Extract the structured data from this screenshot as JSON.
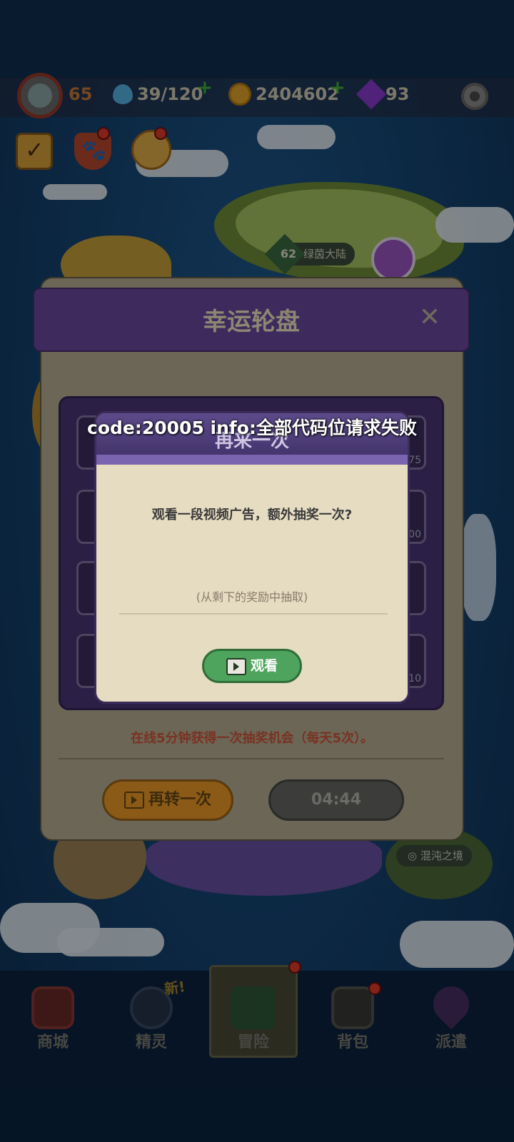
{
  "resources": {
    "level": "65",
    "energy": "39/120",
    "coins": "2404602",
    "gems": "93",
    "plus": "+"
  },
  "map": {
    "island_level": "62",
    "island_name": "绿茵大陆",
    "chaos_name": "混沌之境",
    "chaos_icon": "◎"
  },
  "wheel_panel": {
    "title": "幸运轮盘",
    "close": "✕",
    "prizes": [
      "75",
      "00",
      "10"
    ],
    "rule": "在线5分钟获得一次抽奖机会（每天5次）。",
    "spin_label": "再转一次",
    "timer": "04:44"
  },
  "ad_modal": {
    "title": "再来一次",
    "message": "观看一段视频广告，额外抽奖一次?",
    "sub": "(从剩下的奖励中抽取)",
    "watch_label": "观看"
  },
  "toast": {
    "error": "code:20005 info:全部代码位请求失败"
  },
  "nav": {
    "new_tag": "新!",
    "items": [
      {
        "label": "商城"
      },
      {
        "label": "精灵"
      },
      {
        "label": "冒险"
      },
      {
        "label": "背包"
      },
      {
        "label": "派遣"
      }
    ]
  },
  "colors": {
    "dialog_bg": "#e6dcc2",
    "dialog_header": "#4d3c7a",
    "watch_button": "#4ea45c",
    "rule_text": "#7a3222",
    "notification": "#e23b2b"
  }
}
